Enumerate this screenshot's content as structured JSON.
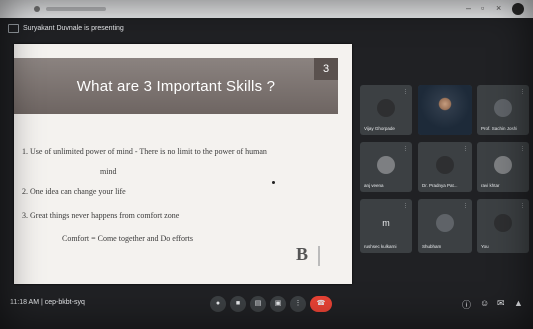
{
  "browser": {
    "window_controls": [
      "–",
      "▫",
      "×"
    ]
  },
  "meeting": {
    "presenting_banner": "Suryakant Duvnale is presenting",
    "meeting_info": "11:18 AM  |  cep-bkbt-syq"
  },
  "slide": {
    "title": "What are 3 Important Skills ?",
    "number": "3",
    "lines": [
      "1. Use of unlimited power of mind - There is no limit to the power of human",
      "mind",
      "2. One idea can change your life",
      "3. Great things never happens from comfort zone",
      "Comfort = Come together and Do efforts"
    ],
    "logo_letter": "B"
  },
  "participants": [
    {
      "name": "Vijay Ghorpade",
      "kind": "avatar"
    },
    {
      "name": "",
      "kind": "video"
    },
    {
      "name": "Prof. Sachin Joshi",
      "kind": "avatar"
    },
    {
      "name": "anj veena",
      "kind": "avatar"
    },
    {
      "name": "Dr. Pradnya Pat...",
      "kind": "avatar"
    },
    {
      "name": "ravi khtar",
      "kind": "avatar"
    },
    {
      "name": "rushsec kulkarni",
      "kind": "avatar"
    },
    {
      "name": "Shubham",
      "kind": "avatar"
    },
    {
      "name": "You",
      "kind": "avatar"
    }
  ],
  "tile_letters": {
    "rushsec": "m"
  },
  "controls": {
    "mic_icon": "mic-icon",
    "cam_icon": "camera-icon",
    "cc_icon": "captions-icon",
    "present_icon": "present-icon",
    "more_icon": "more-icon",
    "leave_icon": "hang-up-icon"
  }
}
